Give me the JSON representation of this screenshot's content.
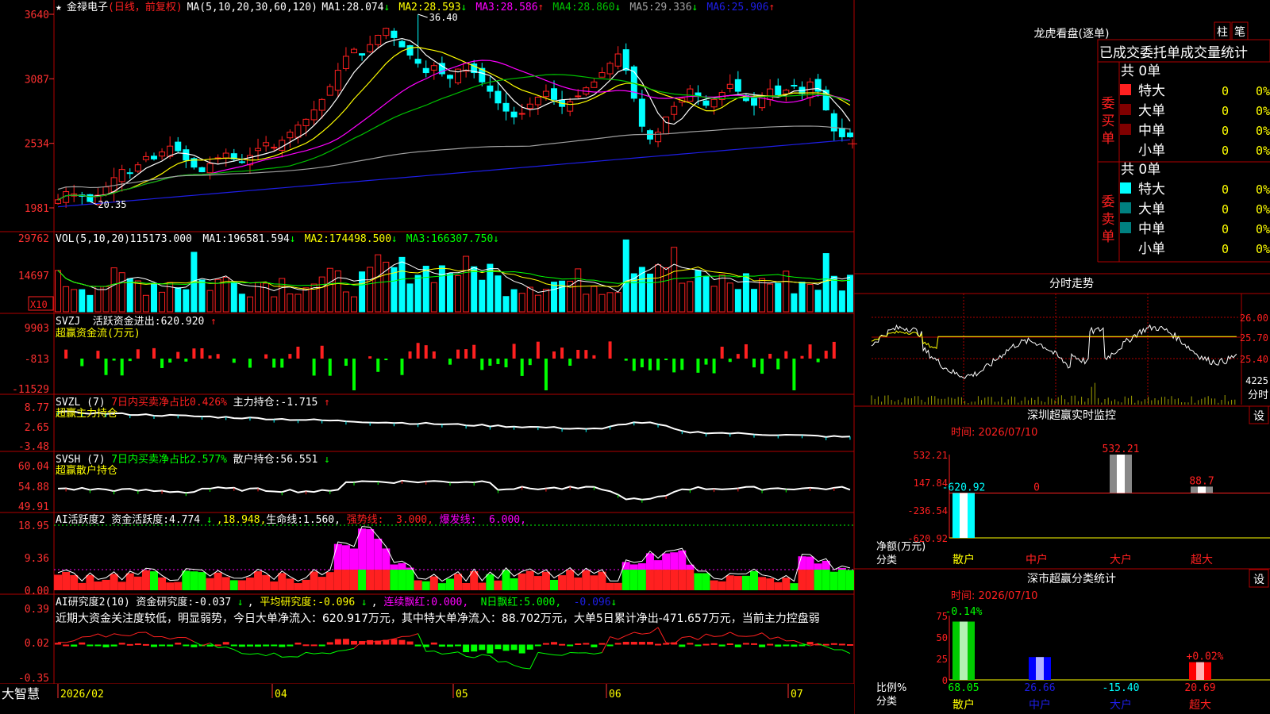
{
  "colors": {
    "up": "#ff2020",
    "down": "#00ffff",
    "frame": "#b00000",
    "white": "#ffffff",
    "yellow": "#ffff00",
    "magenta": "#ff00ff",
    "green": "#00ff00",
    "ma4": "#00c000",
    "ma5": "#a0a0a0",
    "ma6": "#1e1ee6",
    "teal": "#008080",
    "darkred": "#800000",
    "label": "#ff3030"
  },
  "main": {
    "title": "金禄电子",
    "mode": "(日线，前复权)",
    "ma_group": "MA(5,10,20,30,60,120)",
    "ma_items": [
      {
        "label": "MA1:",
        "value": "28.074",
        "arrow": "↓",
        "color": "#ffffff"
      },
      {
        "label": "MA2:",
        "value": "28.593",
        "arrow": "↓",
        "color": "#ffff00"
      },
      {
        "label": "MA3:",
        "value": "28.586",
        "arrow": "↑",
        "color": "#ff00ff"
      },
      {
        "label": "MA4:",
        "value": "28.860",
        "arrow": "↓",
        "color": "#00c000"
      },
      {
        "label": "MA5:",
        "value": "29.336",
        "arrow": "↓",
        "color": "#a0a0a0"
      },
      {
        "label": "MA6:",
        "value": "25.906",
        "arrow": "↑",
        "color": "#1e1ee6"
      }
    ],
    "y_ticks": [
      "3640",
      "3087",
      "2534",
      "1981"
    ],
    "high_label": "36.40",
    "low_label": "20.35"
  },
  "vol": {
    "label": "VOL(5,10,20)",
    "value": "115173.000",
    "items": [
      {
        "label": "MA1:",
        "value": "196581.594",
        "arrow": "↓",
        "color": "#ffffff"
      },
      {
        "label": "MA2:",
        "value": "174498.500",
        "arrow": "↓",
        "color": "#ffff00"
      },
      {
        "label": "MA3:",
        "value": "166307.750",
        "arrow": "↓",
        "color": "#00ff00"
      }
    ],
    "y_ticks": [
      "29762",
      "14697"
    ],
    "unit": "X10"
  },
  "svzj": {
    "name": "SVZJ",
    "label": "活跃资金进出:",
    "value": "620.920",
    "arrow": "↑",
    "sub": "超赢资金流(万元)",
    "y_ticks": [
      "9903",
      "-813",
      "-11529"
    ]
  },
  "svzl": {
    "name": "SVZL (7)",
    "note": "7日内买卖净占比0.426%",
    "label": "主力持仓:",
    "value": "-1.715",
    "arrow": "↑",
    "sub": "超赢主力持仓",
    "y_ticks": [
      "8.77",
      "2.65",
      "-3.48"
    ]
  },
  "svsh": {
    "name": "SVSH (7)",
    "note": "7日内买卖净占比2.577%",
    "label": "散户持仓:",
    "value": "56.551",
    "arrow": "↓",
    "sub": "超赢散户持仓",
    "y_ticks": [
      "60.04",
      "54.88",
      "49.91"
    ]
  },
  "ai1": {
    "name": "AI活跃度2",
    "label": "资金活跃度:",
    "value": "4.774",
    "arrow": "↓",
    "v2": "18.948",
    "l3": "生命线:",
    "v3": "1.560",
    "l4": "强势线:",
    "v4": "3.000",
    "l5": "爆发线:",
    "v5": "6.000",
    "y_ticks": [
      "18.95",
      "9.36",
      "0.00"
    ]
  },
  "ai2": {
    "name": "AI研究度2(10)",
    "label": "资金研究度:",
    "value": "-0.037",
    "arrow": "↓",
    "l2": "平均研究度:",
    "v2": "-0.096",
    "arrow2": "↓",
    "l3": "连续飘红:",
    "v3": "0.000",
    "l4": "N日飘红:",
    "v4": "5.000",
    "v5": "-0.096",
    "y_ticks": [
      "0.39",
      "0.02",
      "-0.35"
    ],
    "comment": "近期大资金关注度较低，明显弱势，今日大单净流入：620.917万元，其中特大单净流入：88.702万元，大单5日累计净出-471.657万元，当前主力控盘弱"
  },
  "x_axis": {
    "brand": "大智慧",
    "labels": [
      "2026/02",
      "04",
      "05",
      "06",
      "07"
    ]
  },
  "side": {
    "lhb_title": "龙虎看盘(逐单)",
    "btn_col": "柱",
    "btn_pen": "笔",
    "stat_title": "已成交委托单成交量统计",
    "buy_label": "委买单",
    "sell_label": "委卖单",
    "count_label": "共 0单",
    "rows": [
      {
        "name": "特大",
        "v": "0",
        "p": "0%"
      },
      {
        "name": "大单",
        "v": "0",
        "p": "0%"
      },
      {
        "name": "中单",
        "v": "0",
        "p": "0%"
      },
      {
        "name": "小单",
        "v": "0",
        "p": "0%"
      }
    ],
    "ts_title": "分时走势",
    "ts_y": [
      "26.00",
      "25.70",
      "25.40"
    ],
    "ts_vol": "4225",
    "ts_unit": "分时",
    "mon_title": "深圳超赢实时监控",
    "mon_btn": "设",
    "mon_time": "时间: 2026/07/10",
    "mon_y": [
      "532.21",
      "147.84",
      "-236.54",
      "-620.92"
    ],
    "mon_x": [
      "散户",
      "中户",
      "大户",
      "超大"
    ],
    "mon_values": [
      -620.92,
      0,
      532.21,
      88.7
    ],
    "mon_value_labels": [
      "-620.92",
      "0",
      "532.21",
      "88.7"
    ],
    "mon_axis_label": "净额(万元)",
    "mon_axis_sub": "分类",
    "cls_title": "深市超赢分类统计",
    "cls_btn": "设",
    "cls_time": "时间: 2026/07/10",
    "cls_y": [
      "75",
      "50",
      "25",
      "0"
    ],
    "cls_x": [
      "散户",
      "中户",
      "大户",
      "超大"
    ],
    "cls_values": [
      68.05,
      26.66,
      -15.4,
      20.69
    ],
    "cls_value_labels": [
      "68.05",
      "26.66",
      "-15.40",
      "20.69"
    ],
    "cls_top_labels": [
      "-0.14%",
      "",
      "",
      "+0.02%"
    ],
    "cls_axis_label": "比例%",
    "cls_axis_sub": "分类"
  },
  "chart_data": [
    {
      "type": "candlestick",
      "title": "金禄电子",
      "period": "daily",
      "adjust": "前复权",
      "ylim": [
        19.81,
        36.4
      ],
      "y_ticks": [
        36.4,
        30.87,
        25.34,
        19.81
      ],
      "x": [
        "2026/02",
        "04",
        "05",
        "06",
        "07"
      ],
      "approx_close": [
        20.5,
        21.2,
        21.0,
        20.8,
        20.35,
        20.9,
        21.6,
        22.4,
        23.1,
        22.8,
        23.5,
        24.2,
        24.0,
        24.6,
        25.1,
        24.7,
        23.9,
        23.3,
        22.9,
        23.6,
        24.1,
        24.5,
        24.0,
        23.7,
        24.3,
        24.9,
        25.4,
        25.0,
        25.6,
        26.3,
        26.9,
        27.4,
        28.2,
        29.1,
        30.2,
        31.6,
        32.8,
        33.4,
        32.9,
        33.8,
        34.6,
        35.2,
        34.4,
        33.6,
        32.9,
        32.2,
        31.4,
        32.0,
        31.3,
        30.9,
        31.7,
        32.2,
        31.4,
        30.6,
        29.8,
        28.8,
        28.1,
        27.6,
        27.9,
        28.7,
        29.3,
        29.8,
        29.1,
        28.5,
        28.9,
        29.4,
        30.1,
        30.6,
        31.4,
        32.2,
        33.0,
        31.6,
        29.2,
        26.8,
        25.7,
        26.3,
        27.6,
        28.5,
        29.2,
        30.0,
        29.4,
        28.6,
        29.1,
        29.7,
        30.4,
        29.8,
        29.0,
        28.6,
        29.4,
        30.0,
        29.5,
        29.9,
        30.3,
        29.6,
        30.6,
        29.8,
        28.2,
        26.4,
        25.9
      ]
    },
    {
      "type": "bar",
      "title": "VOL(5,10,20)",
      "ylim": [
        0,
        29762
      ],
      "y_ticks": [
        29762,
        14697
      ],
      "last": 115173.0,
      "ma": [
        196581.594,
        174498.5,
        166307.75
      ]
    },
    {
      "type": "bar",
      "title": "SVZJ 活跃资金进出",
      "unit": "万元",
      "ylim": [
        -11529,
        9903
      ],
      "y_ticks": [
        9903,
        -813,
        -11529
      ],
      "last": 620.92
    },
    {
      "type": "line",
      "title": "SVZL 主力持仓",
      "ylim": [
        -3.48,
        8.77
      ],
      "y_ticks": [
        8.77,
        2.65,
        -3.48
      ],
      "last": -1.715
    },
    {
      "type": "line",
      "title": "SVSH 散户持仓",
      "ylim": [
        49.91,
        60.04
      ],
      "y_ticks": [
        60.04,
        54.88,
        49.91
      ],
      "last": 56.551
    },
    {
      "type": "bar",
      "title": "AI活跃度2",
      "ylim": [
        0,
        18.95
      ],
      "y_ticks": [
        18.95,
        9.36,
        0.0
      ],
      "last": 4.774,
      "lines": {
        "生命线": 1.56,
        "强势线": 3.0,
        "爆发线": 6.0
      }
    },
    {
      "type": "bar",
      "title": "AI研究度2(10)",
      "ylim": [
        -0.35,
        0.39
      ],
      "y_ticks": [
        0.39,
        0.02,
        -0.35
      ],
      "last": -0.037,
      "avg": -0.096
    },
    {
      "type": "bar",
      "title": "深圳超赢实时监控",
      "categories": [
        "散户",
        "中户",
        "大户",
        "超大"
      ],
      "values": [
        -620.92,
        0,
        532.21,
        88.7
      ],
      "ylim": [
        -620.92,
        532.21
      ],
      "ylabel": "净额(万元)",
      "xlabel": "分类"
    },
    {
      "type": "bar",
      "title": "深市超赢分类统计",
      "categories": [
        "散户",
        "中户",
        "大户",
        "超大"
      ],
      "values": [
        68.05,
        26.66,
        -15.4,
        20.69
      ],
      "ylim": [
        0,
        75
      ],
      "ylabel": "比例%",
      "xlabel": "分类"
    }
  ]
}
